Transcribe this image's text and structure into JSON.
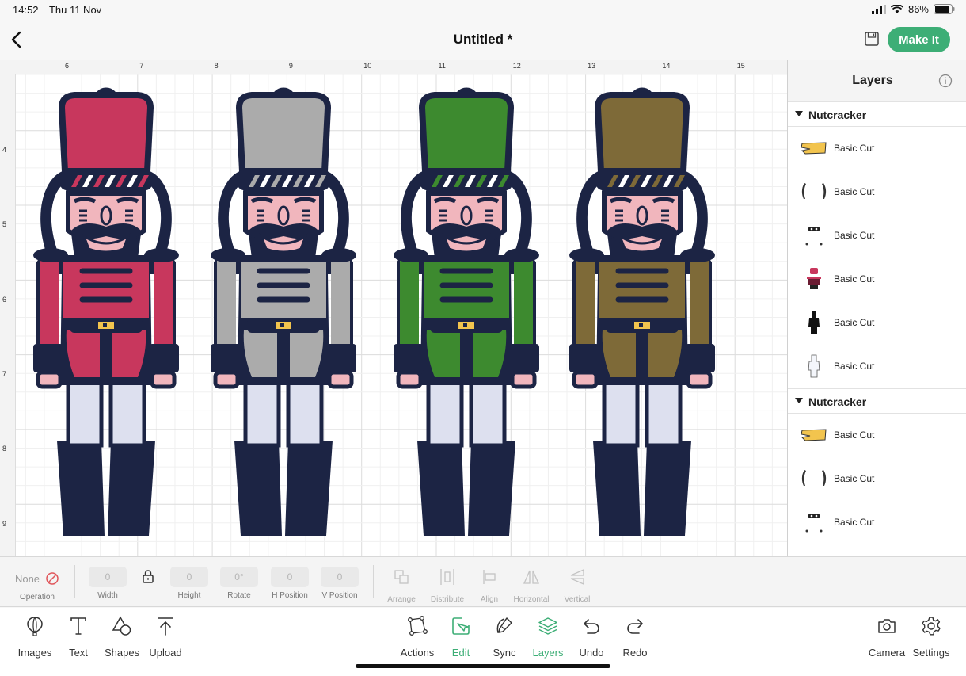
{
  "status": {
    "time": "14:52",
    "date": "Thu 11 Nov",
    "battery": "86%"
  },
  "header": {
    "title": "Untitled *",
    "make_it": "Make It"
  },
  "ruler": {
    "top": [
      "6",
      "7",
      "8",
      "9",
      "10",
      "11",
      "12",
      "13",
      "14",
      "15"
    ],
    "left": [
      "4",
      "5",
      "6",
      "7",
      "8",
      "9"
    ]
  },
  "figures": [
    {
      "hat": "#c8375d",
      "coat": "#c8375d"
    },
    {
      "hat": "#ababab",
      "coat": "#ababab"
    },
    {
      "hat": "#3d8a2f",
      "coat": "#3d8a2f"
    },
    {
      "hat": "#7e6a38",
      "coat": "#7e6a38"
    }
  ],
  "colors": {
    "accent": "#3dae76",
    "navy": "#1c2444",
    "skin": "#f1b6bd",
    "legs": "#dde0ef",
    "gold": "#f2c44e"
  },
  "layers": {
    "title": "Layers",
    "groups": [
      {
        "name": "Nutcracker",
        "items": [
          {
            "label": "Basic Cut",
            "icon": "hat-band-icon"
          },
          {
            "label": "Basic Cut",
            "icon": "hair-icon"
          },
          {
            "label": "Basic Cut",
            "icon": "face-details-icon"
          },
          {
            "label": "Basic Cut",
            "icon": "colored-body-icon"
          },
          {
            "label": "Basic Cut",
            "icon": "dark-silhouette-icon"
          },
          {
            "label": "Basic Cut",
            "icon": "light-silhouette-icon"
          }
        ]
      },
      {
        "name": "Nutcracker",
        "items": [
          {
            "label": "Basic Cut",
            "icon": "hat-band-icon"
          },
          {
            "label": "Basic Cut",
            "icon": "hair-icon"
          },
          {
            "label": "Basic Cut",
            "icon": "face-details-icon"
          }
        ]
      }
    ]
  },
  "editbar": {
    "operation_value": "None",
    "operation": "Operation",
    "width_value": "0",
    "width": "Width",
    "height_value": "0",
    "height": "Height",
    "rotate_value": "0°",
    "rotate": "Rotate",
    "hpos_value": "0",
    "hpos": "H Position",
    "vpos_value": "0",
    "vpos": "V Position",
    "arrange": "Arrange",
    "distribute": "Distribute",
    "align": "Align",
    "horizontal": "Horizontal",
    "vertical": "Vertical"
  },
  "toolbar": {
    "images": "Images",
    "text": "Text",
    "shapes": "Shapes",
    "upload": "Upload",
    "actions": "Actions",
    "edit": "Edit",
    "sync": "Sync",
    "layers": "Layers",
    "undo": "Undo",
    "redo": "Redo",
    "camera": "Camera",
    "settings": "Settings"
  }
}
